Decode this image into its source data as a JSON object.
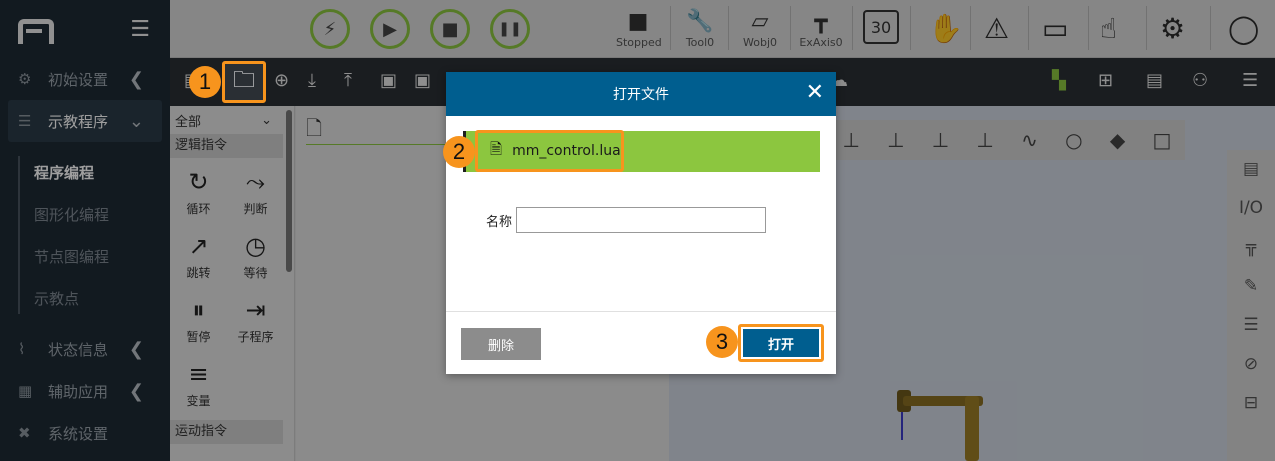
{
  "sidebar": {
    "items": [
      {
        "icon": "gear-icon",
        "glyph": "⚙",
        "label": "初始设置",
        "arrow": "❮"
      },
      {
        "icon": "list-icon",
        "glyph": "☰",
        "label": "示教程序",
        "arrow": "⌄"
      },
      {
        "icon": "pulse-icon",
        "glyph": "⌇",
        "label": "状态信息",
        "arrow": "❮"
      },
      {
        "icon": "grid-icon",
        "glyph": "▦",
        "label": "辅助应用",
        "arrow": "❮"
      },
      {
        "icon": "tools-icon",
        "glyph": "✖",
        "label": "系统设置"
      }
    ],
    "sub_items": [
      "程序编程",
      "图形化编程",
      "节点图编程",
      "示教点"
    ]
  },
  "topbar": {
    "controls": [
      {
        "name": "enable",
        "glyph": "⚡"
      },
      {
        "name": "run",
        "glyph": "▶"
      },
      {
        "name": "stop",
        "glyph": "■"
      },
      {
        "name": "pause",
        "glyph": "❚❚"
      }
    ],
    "status": [
      {
        "label": "Stopped",
        "glyph": "■"
      },
      {
        "label": "Tool0",
        "glyph": "🔧"
      },
      {
        "label": "Wobj0",
        "glyph": "▱"
      },
      {
        "label": "ExAxis0",
        "glyph": "┳"
      }
    ],
    "speed": "30"
  },
  "instructions": {
    "filter": "全部",
    "category_logic": "逻辑指令",
    "items": [
      {
        "label": "循环",
        "glyph": "↻"
      },
      {
        "label": "判断",
        "glyph": "⤳"
      },
      {
        "label": "跳转",
        "glyph": "↗"
      },
      {
        "label": "等待",
        "glyph": "◷"
      },
      {
        "label": "暂停",
        "glyph": "⏸"
      },
      {
        "label": "子程序",
        "glyph": "⇥"
      },
      {
        "label": "变量",
        "glyph": "≡"
      }
    ],
    "category_motion": "运动指令"
  },
  "dialog": {
    "title": "打开文件",
    "close": "✕",
    "file_name": "mm_control.lua",
    "name_label": "名称",
    "name_value": "",
    "delete_label": "删除",
    "open_label": "打开"
  },
  "steps": [
    "1",
    "2",
    "3"
  ],
  "colors": {
    "accent_green": "#8cc63f",
    "brand_blue": "#005e8f",
    "highlight_orange": "#f7941d",
    "sidebar_bg": "#1e2a35"
  }
}
